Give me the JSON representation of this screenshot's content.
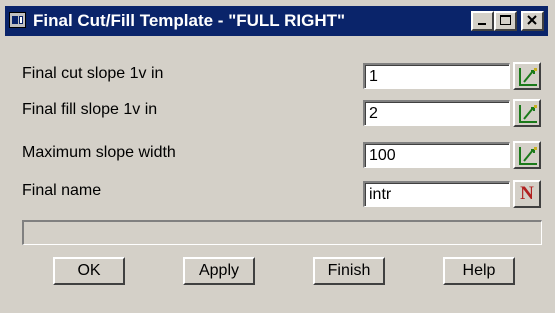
{
  "window": {
    "title": "Final Cut/Fill Template - \"FULL RIGHT\""
  },
  "rows": [
    {
      "label": "Final cut slope  1v in",
      "value": "1",
      "action_icon": "pick-icon"
    },
    {
      "label": "Final fill slope 1v in",
      "value": "2",
      "action_icon": "pick-icon"
    },
    {
      "label": "Maximum slope width",
      "value": "100",
      "action_icon": "pick-icon"
    },
    {
      "label": "Final name",
      "value": "intr",
      "action_icon": "n-icon",
      "action_label": "N"
    }
  ],
  "status_text": "",
  "buttons": {
    "ok": "OK",
    "apply": "Apply",
    "finish": "Finish",
    "help": "Help"
  },
  "colors": {
    "titlebar": "#0a246a",
    "face": "#d4d0c8",
    "pick_icon": "#1a7a1a",
    "n_icon": "#b02020"
  }
}
